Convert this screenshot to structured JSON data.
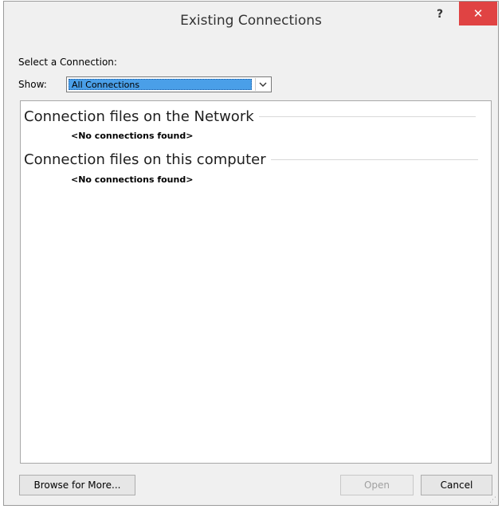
{
  "window": {
    "title": "Existing Connections",
    "help_glyph": "?",
    "close_glyph": "✕"
  },
  "form": {
    "select_label": "Select a Connection:",
    "show_label": "Show:",
    "show_value": "All Connections",
    "dropdown_glyph": "⌄"
  },
  "list": {
    "groups": [
      {
        "header": "Connection files on the Network",
        "empty_text": "<No connections found>"
      },
      {
        "header": "Connection files on this computer",
        "empty_text": "<No connections found>"
      }
    ]
  },
  "buttons": {
    "browse": "Browse for More...",
    "open": "Open",
    "cancel": "Cancel"
  }
}
